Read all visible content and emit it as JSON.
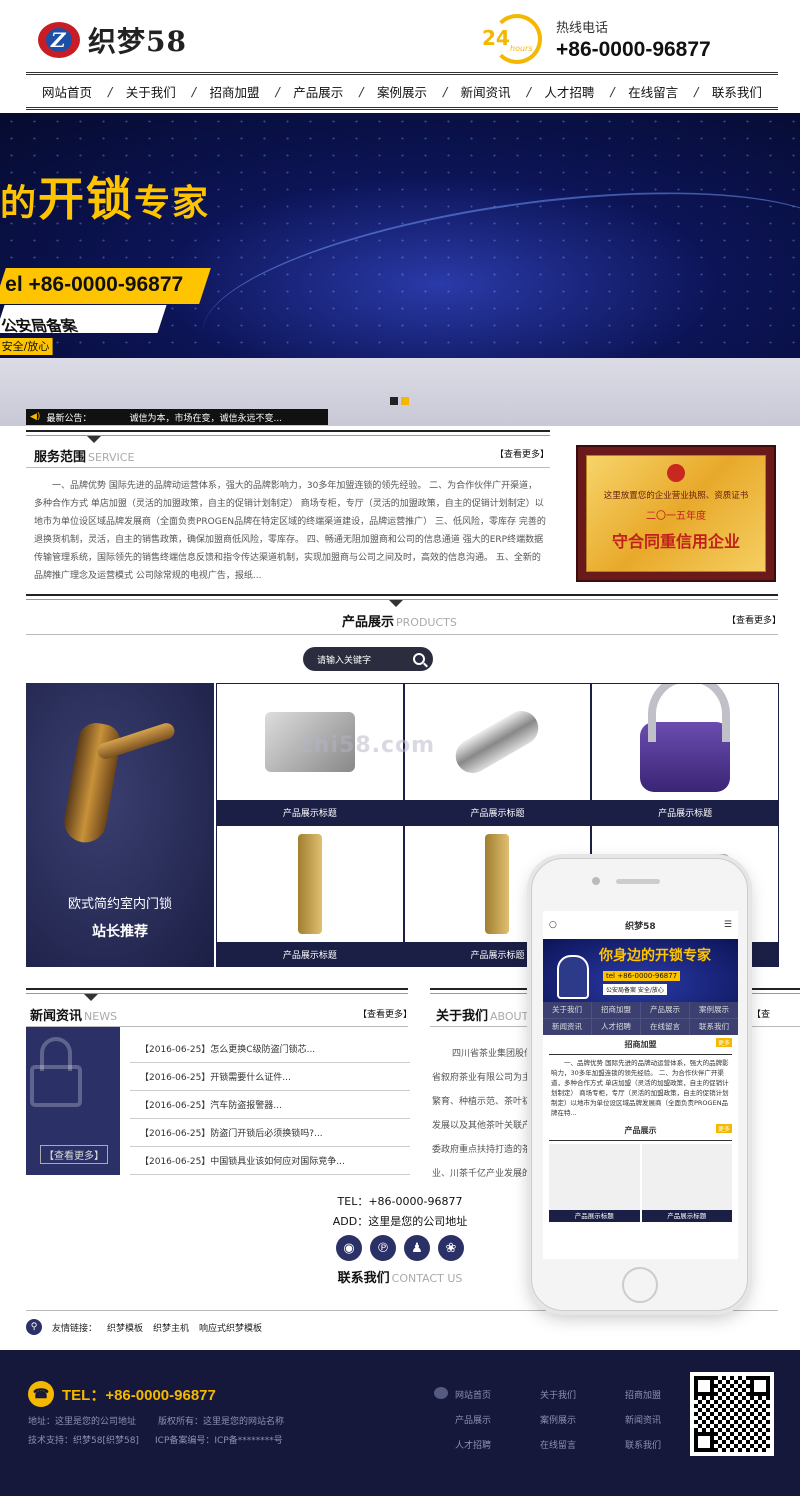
{
  "header": {
    "logo_text": "织梦58",
    "hotline_label": "热线电话",
    "hotline_number": "+86-0000-96877",
    "clock_num": "24",
    "clock_text": "hours"
  },
  "nav": [
    "网站首页",
    "关于我们",
    "招商加盟",
    "产品展示",
    "案例展示",
    "新闻资讯",
    "人才招聘",
    "在线留言",
    "联系我们"
  ],
  "banner": {
    "title_a": "的",
    "title_b": "开锁",
    "title_c": "专家",
    "phone": "el +86-0000-96877",
    "badge": "公安局备案",
    "badge_tag": "安全/放心"
  },
  "notice": {
    "label": "最新公告：",
    "text": "诚信为本，市场在变，诚信永远不变..."
  },
  "service": {
    "title": "服务范围",
    "title_en": "SERVICE",
    "more": "【查看更多】",
    "text": "一、品牌优势 国际先进的品牌动运营体系，强大的品牌影响力，30多年加盟连锁的领先经验。 二、为合作伙伴广开渠道，多种合作方式 单店加盟（灵活的加盟政策，自主的促销计划制定） 商场专柜，专厅（灵活的加盟政策，自主的促销计划制定）以地市为单位设区域品牌发展商（全面负责PROGEN品牌在特定区域的终端渠道建设，品牌运营推广） 三、低风险，零库存 完善的退换货机制，灵活，自主的销售政策，确保加盟商低风险，零库存。 四、畅通无阻加盟商和公司的信息通道 强大的ERP终端数据传输管理系统，国际领先的销售终端信息反馈和指令传达渠道机制，实现加盟商与公司之间及时，高效的信息沟通。 五、全新的品牌推广理念及运营模式 公司除常规的电视广告，报纸...",
    "cert_l1": "这里放置您的企业营业执照、资质证书",
    "cert_l2": "二〇一五年度",
    "cert_l3": "守合同重信用企业"
  },
  "products": {
    "title": "产品展示",
    "title_en": "PRODUCTS",
    "more": "【查看更多】",
    "search_placeholder": "请输入关键字",
    "feature_1": "欧式简约室内门锁",
    "feature_2": "站长推荐",
    "items": [
      "产品展示标题",
      "产品展示标题",
      "产品展示标题",
      "产品展示标题",
      "产品展示标题",
      "产品展示标题"
    ],
    "watermark": "zhi58.com"
  },
  "news": {
    "title": "新闻资讯",
    "title_en": "NEWS",
    "more": "【查看更多】",
    "side_more": "【查看更多】",
    "items": [
      "【2016-06-25】怎么更换C级防盗门锁芯...",
      "【2016-06-25】开锁需要什么证件...",
      "【2016-06-25】汽车防盗报警器...",
      "【2016-06-25】防盗门开锁后必须换锁吗?...",
      "【2016-06-25】中国锁具业该如何应对国际竞争..."
    ]
  },
  "about": {
    "title": "关于我们",
    "title_en": "ABOUT",
    "more": "【查看更多】",
    "lines": [
      "四川省茶业集团股份有限公司（简称四川",
      "省叙府茶业有限公司为主体，联合四川良种",
      "繁育、种植示范、茶叶初加工，精深加工、茶旅游",
      "发展以及其他茶叶关联产业公司，是集茶叶各级党",
      "委政府重点扶持打造的茶业龙头企业，四川茶业龙头企",
      "业、川茶千亿产业发展的..."
    ]
  },
  "contact": {
    "tel": "TEL：+86-0000-96877",
    "addr": "ADD：这里是您的公司地址",
    "title": "联系我们",
    "title_en": "CONTACT US"
  },
  "links": {
    "label": "友情链接：",
    "items": [
      "织梦模板",
      "织梦主机",
      "响应式织梦模板"
    ]
  },
  "footer": {
    "phone": "TEL：+86-0000-96877",
    "addr": "地址：这里是您的公司地址",
    "copyright": "版权所有：这里是您的网站名称",
    "tech": "技术支持：织梦58[织梦58]",
    "icp": "ICP备案编号：ICP备********号",
    "nav": [
      "网站首页",
      "关于我们",
      "招商加盟",
      "产品展示",
      "案例展示",
      "新闻资讯",
      "人才招聘",
      "在线留言",
      "联系我们"
    ]
  },
  "phone_mock": {
    "logo": "织梦58",
    "ban_t": "你身边的开锁专家",
    "ban_p": "tel +86-0000-96877",
    "ban_b": "公安局备案 安全/放心",
    "nav": [
      "关于我们",
      "招商加盟",
      "产品展示",
      "案例展示",
      "新闻资讯",
      "人才招聘",
      "在线留言",
      "联系我们"
    ],
    "sec1": "招商加盟",
    "sec2": "产品展示",
    "more": "更多",
    "text": "一、品牌优势 国际先进的品牌动运营体系，强大的品牌影响力，30多年加盟连锁的领先经验。 二、为合作伙伴广开渠道，多种合作方式 单店加盟（灵活的加盟政策，自主的促销计划制定） 商场专柜，专厅（灵活的加盟政策，自主的促销计划制定）以地市为单位设区域品牌发展商（全面负责PROGEN品牌在特...",
    "prods": [
      "产品展示标题",
      "产品展示标题"
    ]
  },
  "colors": {
    "accent": "#f5b800",
    "navy": "#1b1f45"
  }
}
